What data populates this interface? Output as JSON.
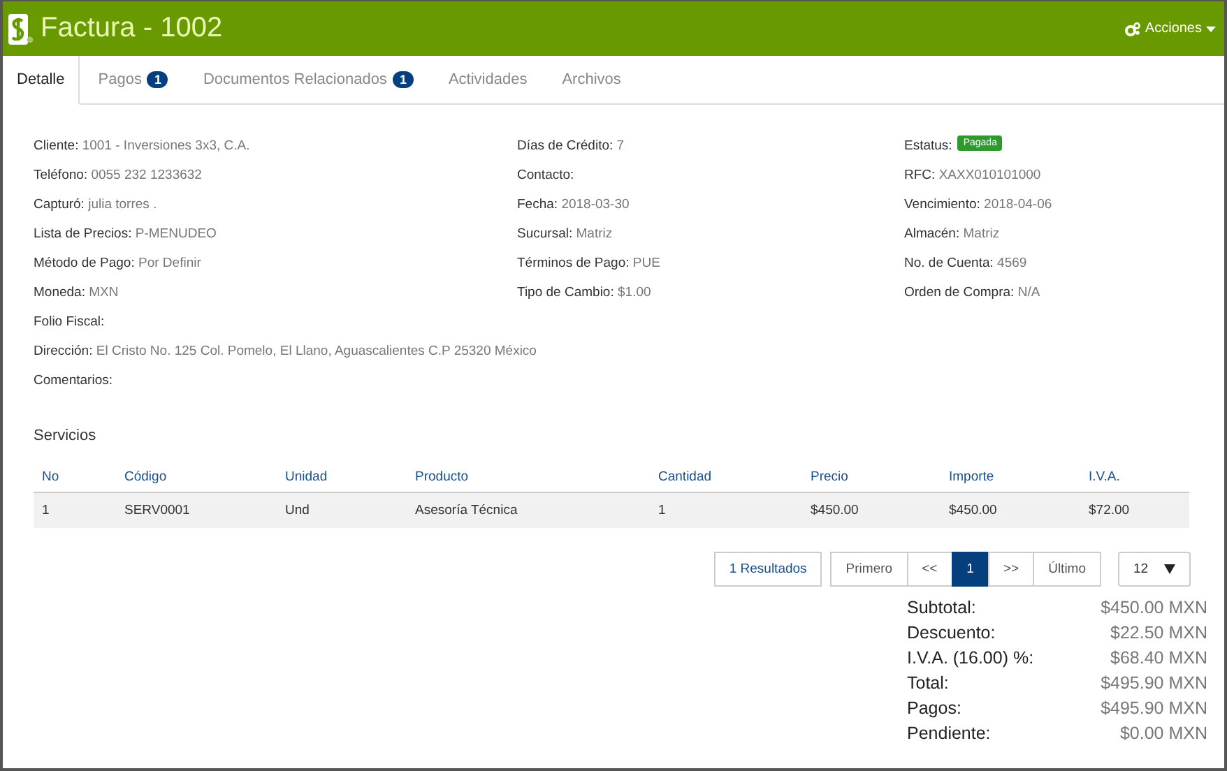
{
  "window": {
    "title": "Factura - 1002"
  },
  "actions": {
    "label": "Acciones"
  },
  "tabs": [
    {
      "label": "Detalle",
      "selected": true
    },
    {
      "label": "Pagos",
      "badge": "1",
      "selected": false
    },
    {
      "label": "Documentos Relacionados",
      "badge": "1",
      "selected": false
    },
    {
      "label": "Actividades",
      "selected": false
    },
    {
      "label": "Archivos",
      "selected": false
    }
  ],
  "details": {
    "columns": [
      [
        {
          "label": "Cliente:",
          "value": "1001 - Inversiones 3x3, C.A."
        },
        {
          "label": "Teléfono:",
          "value": "0055 232 1233632"
        },
        {
          "label": "Capturó:",
          "value": "julia torres ."
        },
        {
          "label": "Lista de Precios:",
          "value": "P-MENUDEO"
        },
        {
          "label": "Método de Pago:",
          "value": "Por Definir"
        },
        {
          "label": "Moneda:",
          "value": "MXN"
        },
        {
          "label": "Folio Fiscal:"
        },
        {
          "label": "Dirección:",
          "value": "El Cristo No. 125 Col. Pomelo, El Llano, Aguascalientes C.P 25320 México"
        },
        {
          "label": "Comentarios:"
        }
      ],
      [
        {
          "label": "Días de Crédito:",
          "value": "7"
        },
        {
          "label": "Contacto:"
        },
        {
          "label": "Fecha:",
          "value": "2018-03-30"
        },
        {
          "label": "Sucursal:",
          "value": "Matriz"
        },
        {
          "label": "Términos de Pago:",
          "value": "PUE"
        },
        {
          "label": "Tipo de Cambio:",
          "value": "$1.00"
        }
      ],
      [
        {
          "label": "Estatus:",
          "badge": "Pagada"
        },
        {
          "label": "RFC:",
          "value": "XAXX010101000"
        },
        {
          "label": "Vencimiento:",
          "value": "2018-04-06"
        },
        {
          "label": "Almacén:",
          "value": "Matriz"
        },
        {
          "label": "No. de Cuenta:",
          "value": "4569"
        },
        {
          "label": "Orden de Compra:",
          "value": "N/A"
        }
      ]
    ]
  },
  "services": {
    "title": "Servicios",
    "columns": [
      "No",
      "Código",
      "Unidad",
      "Producto",
      "Cantidad",
      "Precio",
      "Importe",
      "I.V.A."
    ],
    "rows": [
      [
        "1",
        "SERV0001",
        "Und",
        "Asesoría Técnica",
        "1",
        "$450.00",
        "$450.00",
        "$72.00"
      ]
    ]
  },
  "pagination": {
    "results": "1 Resultados",
    "pages": [
      {
        "label": "Primero",
        "selected": false
      },
      {
        "label": "<<",
        "selected": false
      },
      {
        "label": "1",
        "selected": true
      },
      {
        "label": ">>",
        "selected": false
      },
      {
        "label": "Último",
        "selected": false
      }
    ],
    "page_size": "12"
  },
  "totals": [
    {
      "label": "Subtotal:",
      "value": "$450.00 MXN"
    },
    {
      "label": "Descuento:",
      "value": "$22.50 MXN"
    },
    {
      "label": "I.V.A. (16.00) %:",
      "value": "$68.40 MXN"
    },
    {
      "label": "Total:",
      "value": "$495.90 MXN"
    },
    {
      "label": "Pagos:",
      "value": "$495.90 MXN"
    },
    {
      "label": "Pendiente:",
      "value": "$0.00 MXN"
    }
  ]
}
